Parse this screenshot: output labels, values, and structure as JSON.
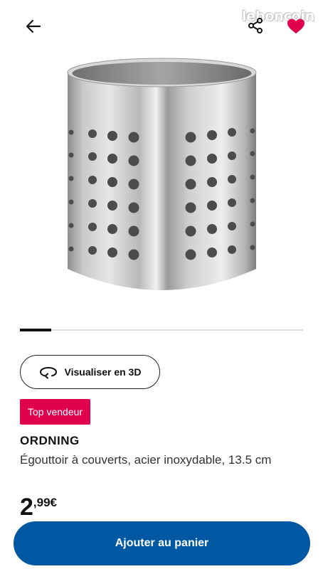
{
  "header": {
    "back_icon": "arrow-left-icon",
    "share_icon": "share-icon",
    "favorite_icon": "heart-icon",
    "watermark": "leboncoin",
    "favorite_color": "#e0004d"
  },
  "gallery": {
    "image_subject": "stainless steel cutlery drainer",
    "progress": 0.11
  },
  "actions": {
    "view_3d_label": "Visualiser en 3D",
    "view_3d_icon": "rotate-3d-icon"
  },
  "product": {
    "badge": "Top vendeur",
    "badge_color": "#e0004d",
    "name": "ORDNING",
    "description": "Égouttoir à couverts, acier inoxydable, 13.5 cm",
    "price_int": "2",
    "price_dec": ",99€"
  },
  "cart": {
    "label": "Ajouter au panier",
    "color": "#0058a3"
  }
}
